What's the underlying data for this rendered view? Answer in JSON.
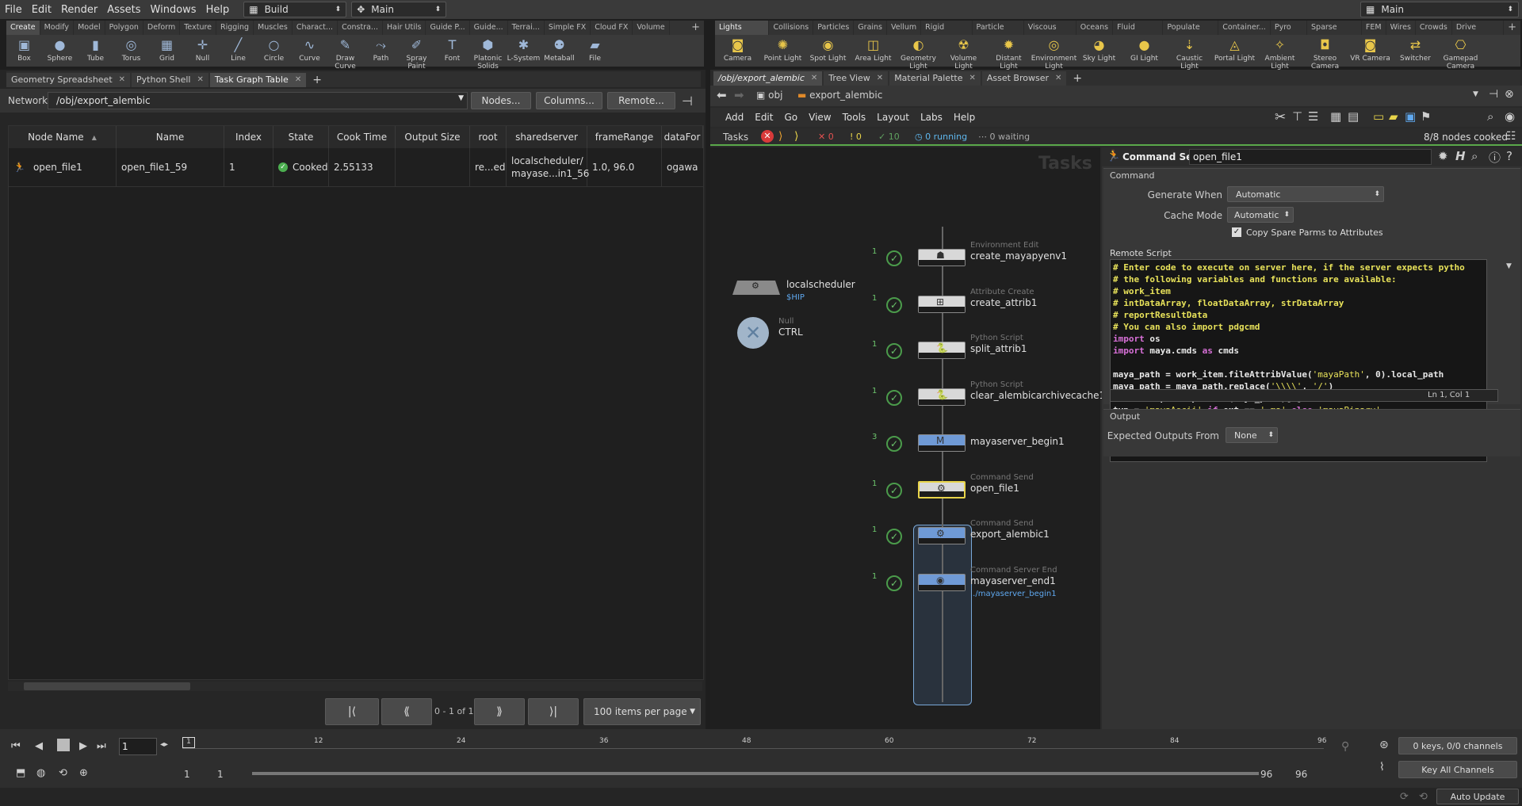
{
  "menubar": {
    "items": [
      "File",
      "Edit",
      "Render",
      "Assets",
      "Windows",
      "Help"
    ],
    "desktop": "Build",
    "context": "Main",
    "right_context": "Main"
  },
  "shelf_left": {
    "tabs": [
      "Create",
      "Modify",
      "Model",
      "Polygon",
      "Deform",
      "Texture",
      "Rigging",
      "Muscles",
      "Charact...",
      "Constra...",
      "Hair Utils",
      "Guide P...",
      "Guide...",
      "Terrai...",
      "Simple FX",
      "Cloud FX",
      "Volume"
    ],
    "tools": [
      "Box",
      "Sphere",
      "Tube",
      "Torus",
      "Grid",
      "Null",
      "Line",
      "Circle",
      "Curve",
      "Draw Curve",
      "Path",
      "Spray Paint",
      "Font",
      "Platonic Solids",
      "L-System",
      "Metaball",
      "File"
    ]
  },
  "shelf_right": {
    "tabs": [
      "Lights and...",
      "Collisions",
      "Particles",
      "Grains",
      "Vellum",
      "Rigid Bod...",
      "Particle Fl...",
      "Viscous Fl...",
      "Oceans",
      "Fluid Con...",
      "Populate C...",
      "Container...",
      "Pyro FX",
      "Sparse Pyr...",
      "FEM",
      "Wires",
      "Crowds",
      "Drive Sim..."
    ],
    "tools": [
      "Camera",
      "Point Light",
      "Spot Light",
      "Area Light",
      "Geometry Light",
      "Volume Light",
      "Distant Light",
      "Environment Light",
      "Sky Light",
      "GI Light",
      "Caustic Light",
      "Portal Light",
      "Ambient Light",
      "Stereo Camera",
      "VR Camera",
      "Switcher",
      "Gamepad Camera"
    ]
  },
  "left_pane": {
    "tabs": [
      "Geometry Spreadsheet",
      "Python Shell",
      "Task Graph Table"
    ],
    "network_label": "Network",
    "network_path": "/obj/export_alembic",
    "buttons": [
      "Nodes...",
      "Columns...",
      "Remote..."
    ],
    "columns": [
      "Node Name",
      "Name",
      "Index",
      "State",
      "Cook Time",
      "Output Size",
      "root",
      "sharedserver",
      "frameRange",
      "dataFor"
    ],
    "rows": [
      {
        "node_name": "open_file1",
        "name": "open_file1_59",
        "index": "1",
        "state": "Cooked",
        "cook_time": "2.55133",
        "output_size": "",
        "root": "re...ed",
        "sharedserver_1": "localscheduler/",
        "sharedserver_2": "mayase...in1_56",
        "frame_range": "1.0, 96.0",
        "data_for": "ogawa"
      }
    ],
    "pager": {
      "text": "0 - 1 of 1",
      "per_page": "100 items per page"
    }
  },
  "right_pane": {
    "tabs": [
      "/obj/export_alembic",
      "Tree View",
      "Material Palette",
      "Asset Browser"
    ],
    "path": {
      "root": "obj",
      "node": "export_alembic"
    },
    "menu": [
      "Add",
      "Edit",
      "Go",
      "View",
      "Tools",
      "Layout",
      "Labs",
      "Help"
    ],
    "tasks": {
      "label": "Tasks",
      "errors": "0",
      "warnings": "0",
      "success": "10",
      "running": "0 running",
      "waiting": "0 waiting",
      "cooked": "8/8 nodes cooked"
    },
    "watermark": "Tasks",
    "side_nodes": [
      {
        "name": "localscheduler",
        "sub": "$HIP"
      },
      {
        "type": "Null",
        "name": "CTRL"
      }
    ],
    "nodes": [
      {
        "type": "Environment Edit",
        "name": "create_mayapyenv1",
        "count": "1"
      },
      {
        "type": "Attribute Create",
        "name": "create_attrib1",
        "count": "1"
      },
      {
        "type": "Python Script",
        "name": "split_attrib1",
        "count": "1"
      },
      {
        "type": "Python Script",
        "name": "clear_alembicarchivecache1",
        "count": "1"
      },
      {
        "type": "",
        "name": "mayaserver_begin1",
        "count": "3"
      },
      {
        "type": "Command Send",
        "name": "open_file1",
        "count": "1"
      },
      {
        "type": "Command Send",
        "name": "export_alembic1",
        "count": "1"
      },
      {
        "type": "Command Server End",
        "name": "mayaserver_end1",
        "count": "1",
        "sub": "../mayaserver_begin1"
      }
    ]
  },
  "params": {
    "node_type": "Command Send",
    "node_name": "open_file1",
    "section": "Command",
    "generate_when_label": "Generate When",
    "generate_when": "Automatic",
    "cache_mode_label": "Cache Mode",
    "cache_mode": "Automatic",
    "copy_spare": "Copy Spare Parms to Attributes",
    "remote_label": "Remote Script",
    "cursor": "Ln 1, Col 1",
    "output_section": "Output",
    "expected_label": "Expected Outputs From",
    "expected": "None"
  },
  "timeline": {
    "frame": "1",
    "ticks": [
      "1",
      "12",
      "24",
      "36",
      "48",
      "60",
      "72",
      "84",
      "96"
    ],
    "start": "1",
    "start2": "1",
    "end": "96",
    "end2": "96",
    "keys": "0 keys, 0/0 channels",
    "key_all": "Key All Channels",
    "auto_update": "Auto Update"
  }
}
